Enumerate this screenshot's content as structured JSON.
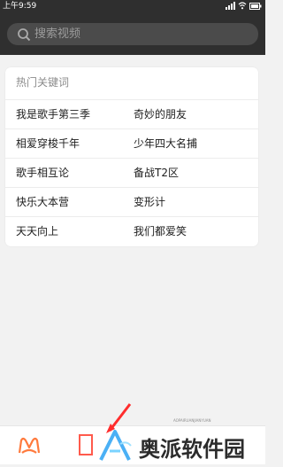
{
  "status": {
    "time": "上午9:59",
    "battery_text": "▮",
    "signal_text": "⫶",
    "wifi_text": "◉"
  },
  "search": {
    "placeholder": "搜索视频"
  },
  "hot": {
    "title": "热门关键词",
    "rows": [
      {
        "left": "我是歌手第三季",
        "right": "奇妙的朋友"
      },
      {
        "left": "相爱穿梭千年",
        "right": "少年四大名捕"
      },
      {
        "left": "歌手相互论",
        "right": "备战T2区"
      },
      {
        "left": "快乐大本营",
        "right": "变形计"
      },
      {
        "left": "天天向上",
        "right": "我们都爱笑"
      }
    ]
  },
  "watermark": {
    "mid": "AOPAIRUANJIANYUAN",
    "logo": "奥派软件园"
  },
  "colors": {
    "dark": "#2f2f2f",
    "accent": "#ff5a4c",
    "logo_accent": "#4bb0f5"
  },
  "icons": {
    "search": "search-icon",
    "tab_home": "mango-home-icon",
    "tab_center": "center-tab-icon"
  }
}
